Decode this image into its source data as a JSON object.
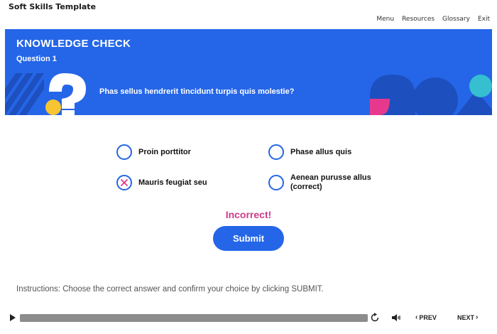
{
  "header": {
    "course_title": "Soft Skills Template",
    "nav": [
      "Menu",
      "Resources",
      "Glossary",
      "Exit"
    ]
  },
  "banner": {
    "title": "KNOWLEDGE CHECK",
    "subtitle": "Question 1",
    "question": "Phas sellus hendrerit tincidunt turpis quis molestie?",
    "colors": {
      "background": "#2566e8",
      "yellow": "#f7c531",
      "pink": "#e6398d",
      "teal": "#35bfd0",
      "dark_blue": "#1d4fbf"
    }
  },
  "options": [
    {
      "label": "Proin porttitor",
      "selected": false,
      "state": "default"
    },
    {
      "label": "Phase allus quis",
      "selected": false,
      "state": "default"
    },
    {
      "label": "Mauris feugiat seu",
      "selected": true,
      "state": "incorrect"
    },
    {
      "label": "Aenean purusse allus (correct)",
      "selected": false,
      "state": "default"
    }
  ],
  "feedback": {
    "text": "Incorrect!",
    "color": "#cf3a8a"
  },
  "submit": {
    "label": "Submit"
  },
  "instructions": "Instructions: Choose the correct answer and confirm your choice by clicking SUBMIT.",
  "player": {
    "progress_fraction": 1.0,
    "prev_label": "PREV",
    "next_label": "NEXT",
    "icons": [
      "play-icon",
      "replay-icon",
      "volume-icon",
      "chevron-left-icon",
      "chevron-right-icon"
    ]
  }
}
